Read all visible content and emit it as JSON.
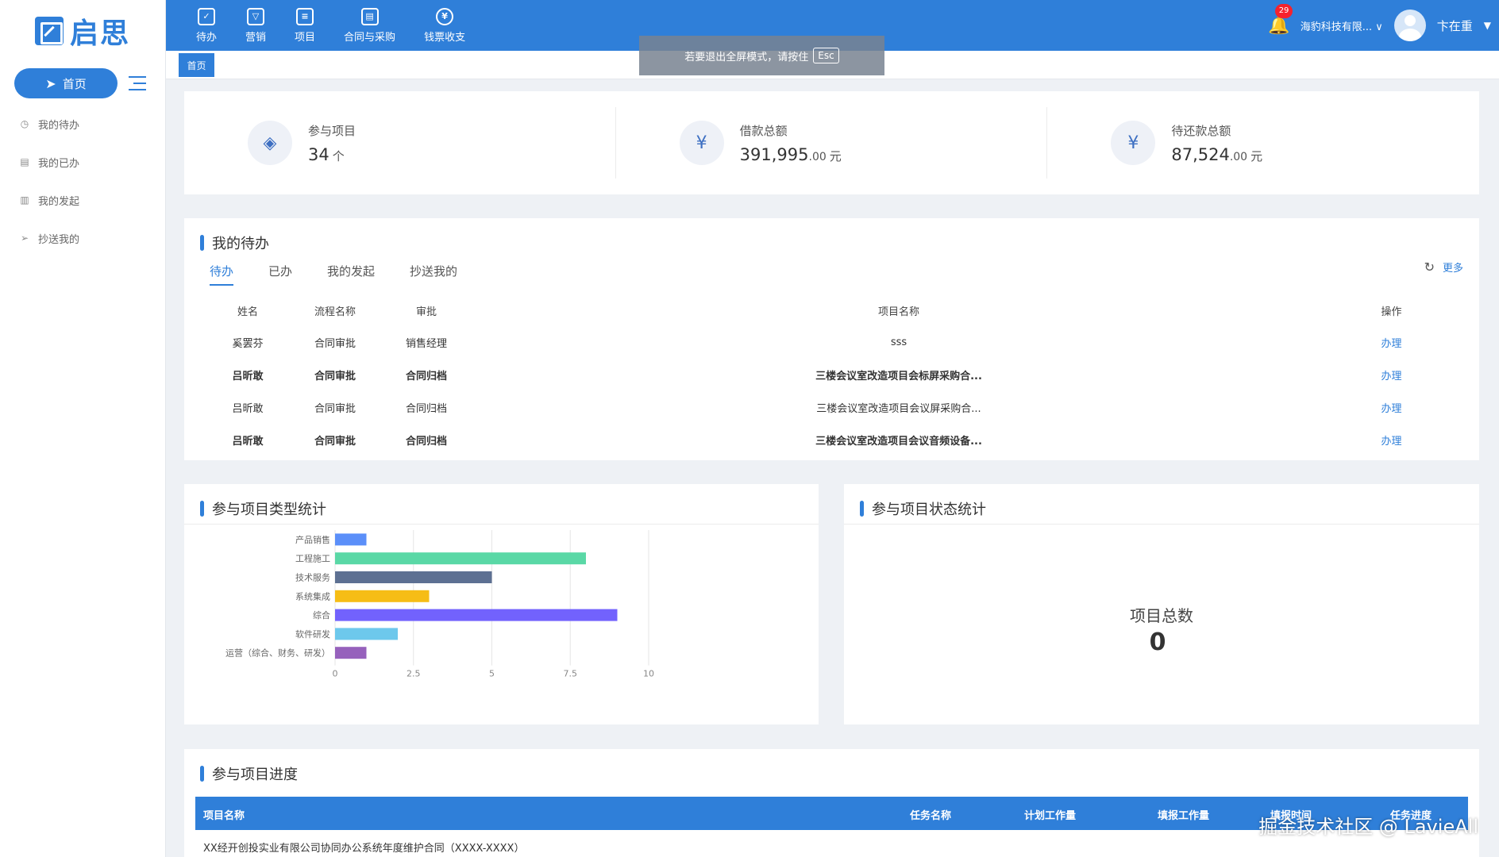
{
  "brand": {
    "logo_text": "启思"
  },
  "sidebar": {
    "home_label": "首页",
    "items": [
      {
        "label": "我的待办",
        "icon": "clock-icon"
      },
      {
        "label": "我的已办",
        "icon": "doc-check-icon"
      },
      {
        "label": "我的发起",
        "icon": "doc-icon"
      },
      {
        "label": "抄送我的",
        "icon": "send-icon"
      }
    ]
  },
  "topnav": {
    "items": [
      {
        "label": "待办",
        "icon": "todo-icon"
      },
      {
        "label": "营销",
        "icon": "funnel-icon"
      },
      {
        "label": "项目",
        "icon": "project-icon"
      },
      {
        "label": "合同与采购",
        "icon": "contract-icon"
      },
      {
        "label": "钱票收支",
        "icon": "yen-icon"
      }
    ],
    "badge_count": "29",
    "company": "海豹科技有限...",
    "username": "卞在重"
  },
  "tabs": {
    "home": "首页"
  },
  "fullscreen_hint": {
    "text": "若要退出全屏模式，请按住",
    "key": "Esc"
  },
  "stats": [
    {
      "label": "参与项目",
      "value": "34",
      "decimal": "",
      "unit": "个"
    },
    {
      "label": "借款总额",
      "value": "391,995",
      "decimal": ".00",
      "unit": "元"
    },
    {
      "label": "待还款总额",
      "value": "87,524",
      "decimal": ".00",
      "unit": "元"
    }
  ],
  "todo": {
    "title": "我的待办",
    "tabs": [
      "待办",
      "已办",
      "我的发起",
      "抄送我的"
    ],
    "more": "更多",
    "columns": [
      "姓名",
      "流程名称",
      "审批",
      "项目名称",
      "操作"
    ],
    "rows": [
      {
        "name": "奚罢芬",
        "flow": "合同审批",
        "approval": "销售经理",
        "project": "sss",
        "op": "办理",
        "bold": false
      },
      {
        "name": "吕昕敢",
        "flow": "合同审批",
        "approval": "合同归档",
        "project": "三楼会议室改造项目会标屏采购合...",
        "op": "办理",
        "bold": true
      },
      {
        "name": "吕昕敢",
        "flow": "合同审批",
        "approval": "合同归档",
        "project": "三楼会议室改造项目会议屏采购合...",
        "op": "办理",
        "bold": false
      },
      {
        "name": "吕昕敢",
        "flow": "合同审批",
        "approval": "合同归档",
        "project": "三楼会议室改造项目会议音频设备...",
        "op": "办理",
        "bold": true
      }
    ]
  },
  "chart_data": {
    "type": "bar",
    "orientation": "horizontal",
    "title": "参与项目类型统计",
    "categories": [
      "产品销售",
      "工程施工",
      "技术服务",
      "系统集成",
      "综合",
      "软件研发",
      "运营（综合、财务、研发）"
    ],
    "values": [
      1,
      8,
      5,
      3,
      9,
      2,
      1
    ],
    "colors": [
      "#5b8ff9",
      "#5ad8a6",
      "#5d7092",
      "#f6bd16",
      "#7262fd",
      "#6dc8ec",
      "#9661bc"
    ],
    "xticks": [
      "0",
      "2.5",
      "5",
      "7.5",
      "10"
    ],
    "xlim": [
      0,
      10
    ],
    "grid": true
  },
  "status_chart": {
    "title": "参与项目状态统计",
    "total_label": "项目总数",
    "total_value": "0"
  },
  "progress": {
    "title": "参与项目进度",
    "columns": [
      "项目名称",
      "任务名称",
      "计划工作量",
      "填报工作量",
      "填报时间",
      "任务进度"
    ],
    "first_row": "XX经开创投实业有限公司协同办公系统年度维护合同（XXXX-XXXX）"
  },
  "credit": "掘金技术社区 @ LavieAll"
}
